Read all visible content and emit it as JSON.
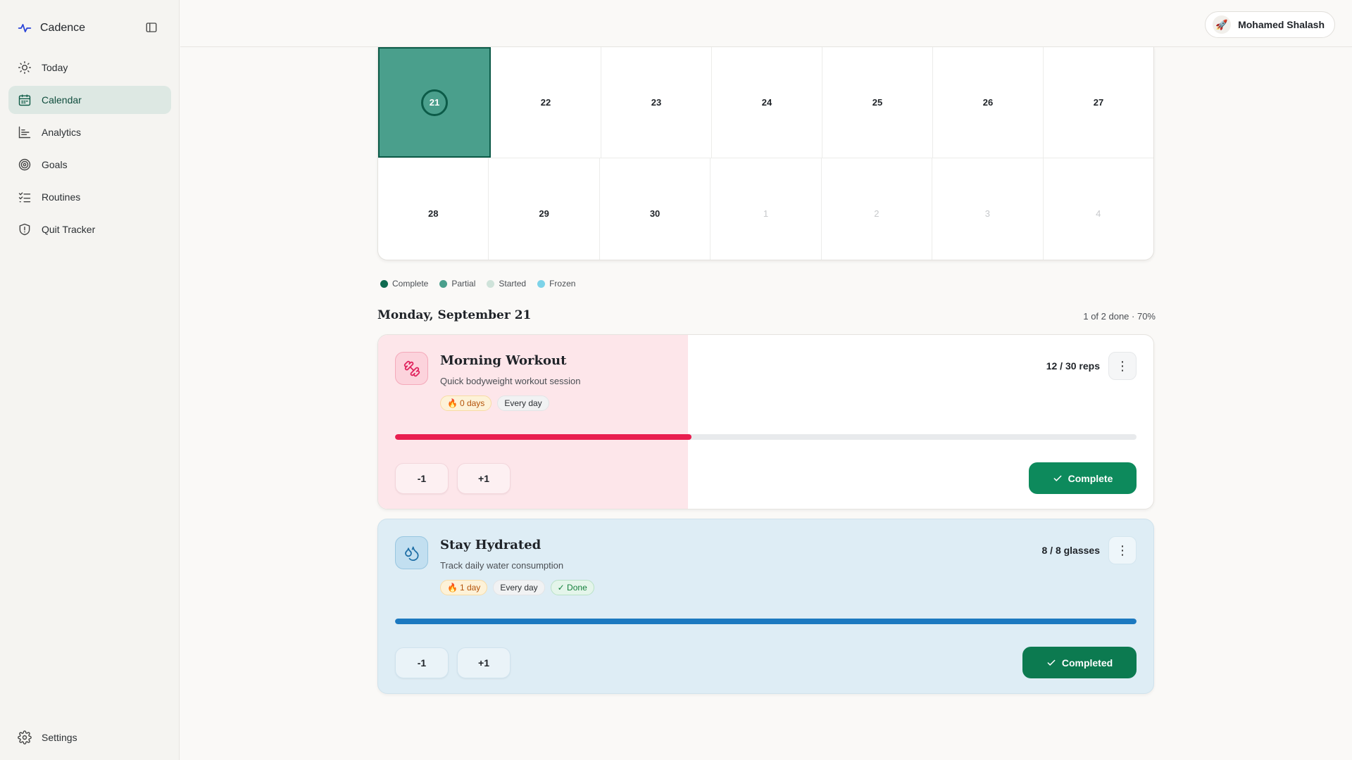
{
  "app": {
    "name": "Cadence"
  },
  "sidebar": {
    "items": [
      {
        "label": "Today"
      },
      {
        "label": "Calendar"
      },
      {
        "label": "Analytics"
      },
      {
        "label": "Goals"
      },
      {
        "label": "Routines"
      },
      {
        "label": "Quit Tracker"
      }
    ],
    "active": "Calendar",
    "settings_label": "Settings"
  },
  "user": {
    "name": "Mohamed Shalash",
    "avatar_icon": "rocket-emoji"
  },
  "calendar": {
    "weeks": [
      [
        {
          "day": "21",
          "selected": true
        },
        {
          "day": "22"
        },
        {
          "day": "23"
        },
        {
          "day": "24"
        },
        {
          "day": "25"
        },
        {
          "day": "26"
        },
        {
          "day": "27"
        }
      ],
      [
        {
          "day": "28"
        },
        {
          "day": "29"
        },
        {
          "day": "30"
        },
        {
          "day": "1",
          "muted": true
        },
        {
          "day": "2",
          "muted": true
        },
        {
          "day": "3",
          "muted": true
        },
        {
          "day": "4",
          "muted": true
        }
      ]
    ],
    "legend": [
      {
        "label": "Complete",
        "color": "#0f6b50"
      },
      {
        "label": "Partial",
        "color": "#4a9f8c"
      },
      {
        "label": "Started",
        "color": "#cfe3da"
      },
      {
        "label": "Frozen",
        "color": "#7dd3e8"
      }
    ]
  },
  "day": {
    "title": "Monday, September 21",
    "summary": "1 of 2 done · 70%"
  },
  "habits": [
    {
      "title": "Morning Workout",
      "description": "Quick bodyweight workout session",
      "streak": "0 days",
      "frequency": "Every day",
      "count": "12 / 30 reps",
      "progress": 0.4,
      "minus_label": "-1",
      "plus_label": "+1",
      "action_label": "Complete",
      "icon": "dumbbell-icon",
      "color": "#e91e4f"
    },
    {
      "title": "Stay Hydrated",
      "description": "Track daily water consumption",
      "streak": "1 day",
      "frequency": "Every day",
      "status": "✓ Done",
      "count": "8 / 8 glasses",
      "progress": 1.0,
      "minus_label": "-1",
      "plus_label": "+1",
      "action_label": "Completed",
      "icon": "water-drops-icon",
      "color": "#1c79c0"
    }
  ]
}
